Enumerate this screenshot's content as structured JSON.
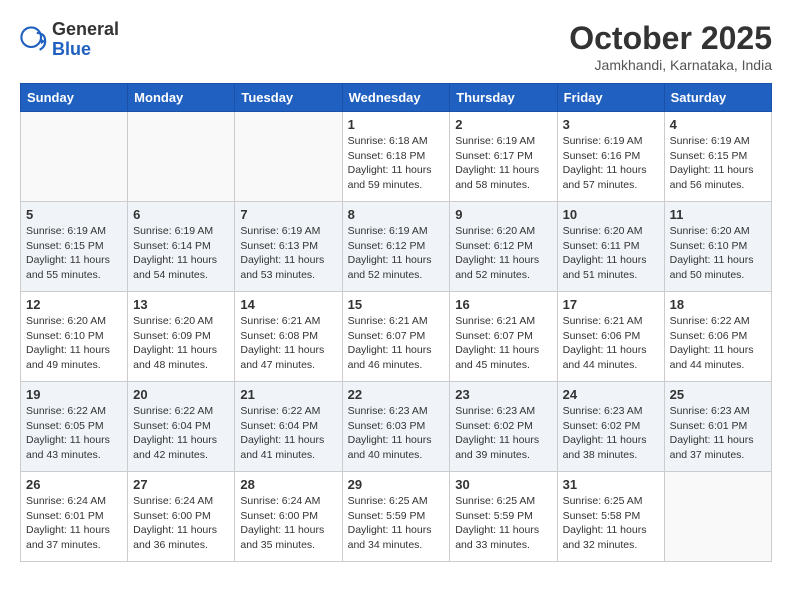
{
  "header": {
    "logo_general": "General",
    "logo_blue": "Blue",
    "month_title": "October 2025",
    "location": "Jamkhandi, Karnataka, India"
  },
  "weekdays": [
    "Sunday",
    "Monday",
    "Tuesday",
    "Wednesday",
    "Thursday",
    "Friday",
    "Saturday"
  ],
  "weeks": [
    [
      {
        "day": "",
        "info": ""
      },
      {
        "day": "",
        "info": ""
      },
      {
        "day": "",
        "info": ""
      },
      {
        "day": "1",
        "info": "Sunrise: 6:18 AM\nSunset: 6:18 PM\nDaylight: 11 hours\nand 59 minutes."
      },
      {
        "day": "2",
        "info": "Sunrise: 6:19 AM\nSunset: 6:17 PM\nDaylight: 11 hours\nand 58 minutes."
      },
      {
        "day": "3",
        "info": "Sunrise: 6:19 AM\nSunset: 6:16 PM\nDaylight: 11 hours\nand 57 minutes."
      },
      {
        "day": "4",
        "info": "Sunrise: 6:19 AM\nSunset: 6:15 PM\nDaylight: 11 hours\nand 56 minutes."
      }
    ],
    [
      {
        "day": "5",
        "info": "Sunrise: 6:19 AM\nSunset: 6:15 PM\nDaylight: 11 hours\nand 55 minutes."
      },
      {
        "day": "6",
        "info": "Sunrise: 6:19 AM\nSunset: 6:14 PM\nDaylight: 11 hours\nand 54 minutes."
      },
      {
        "day": "7",
        "info": "Sunrise: 6:19 AM\nSunset: 6:13 PM\nDaylight: 11 hours\nand 53 minutes."
      },
      {
        "day": "8",
        "info": "Sunrise: 6:19 AM\nSunset: 6:12 PM\nDaylight: 11 hours\nand 52 minutes."
      },
      {
        "day": "9",
        "info": "Sunrise: 6:20 AM\nSunset: 6:12 PM\nDaylight: 11 hours\nand 52 minutes."
      },
      {
        "day": "10",
        "info": "Sunrise: 6:20 AM\nSunset: 6:11 PM\nDaylight: 11 hours\nand 51 minutes."
      },
      {
        "day": "11",
        "info": "Sunrise: 6:20 AM\nSunset: 6:10 PM\nDaylight: 11 hours\nand 50 minutes."
      }
    ],
    [
      {
        "day": "12",
        "info": "Sunrise: 6:20 AM\nSunset: 6:10 PM\nDaylight: 11 hours\nand 49 minutes."
      },
      {
        "day": "13",
        "info": "Sunrise: 6:20 AM\nSunset: 6:09 PM\nDaylight: 11 hours\nand 48 minutes."
      },
      {
        "day": "14",
        "info": "Sunrise: 6:21 AM\nSunset: 6:08 PM\nDaylight: 11 hours\nand 47 minutes."
      },
      {
        "day": "15",
        "info": "Sunrise: 6:21 AM\nSunset: 6:07 PM\nDaylight: 11 hours\nand 46 minutes."
      },
      {
        "day": "16",
        "info": "Sunrise: 6:21 AM\nSunset: 6:07 PM\nDaylight: 11 hours\nand 45 minutes."
      },
      {
        "day": "17",
        "info": "Sunrise: 6:21 AM\nSunset: 6:06 PM\nDaylight: 11 hours\nand 44 minutes."
      },
      {
        "day": "18",
        "info": "Sunrise: 6:22 AM\nSunset: 6:06 PM\nDaylight: 11 hours\nand 44 minutes."
      }
    ],
    [
      {
        "day": "19",
        "info": "Sunrise: 6:22 AM\nSunset: 6:05 PM\nDaylight: 11 hours\nand 43 minutes."
      },
      {
        "day": "20",
        "info": "Sunrise: 6:22 AM\nSunset: 6:04 PM\nDaylight: 11 hours\nand 42 minutes."
      },
      {
        "day": "21",
        "info": "Sunrise: 6:22 AM\nSunset: 6:04 PM\nDaylight: 11 hours\nand 41 minutes."
      },
      {
        "day": "22",
        "info": "Sunrise: 6:23 AM\nSunset: 6:03 PM\nDaylight: 11 hours\nand 40 minutes."
      },
      {
        "day": "23",
        "info": "Sunrise: 6:23 AM\nSunset: 6:02 PM\nDaylight: 11 hours\nand 39 minutes."
      },
      {
        "day": "24",
        "info": "Sunrise: 6:23 AM\nSunset: 6:02 PM\nDaylight: 11 hours\nand 38 minutes."
      },
      {
        "day": "25",
        "info": "Sunrise: 6:23 AM\nSunset: 6:01 PM\nDaylight: 11 hours\nand 37 minutes."
      }
    ],
    [
      {
        "day": "26",
        "info": "Sunrise: 6:24 AM\nSunset: 6:01 PM\nDaylight: 11 hours\nand 37 minutes."
      },
      {
        "day": "27",
        "info": "Sunrise: 6:24 AM\nSunset: 6:00 PM\nDaylight: 11 hours\nand 36 minutes."
      },
      {
        "day": "28",
        "info": "Sunrise: 6:24 AM\nSunset: 6:00 PM\nDaylight: 11 hours\nand 35 minutes."
      },
      {
        "day": "29",
        "info": "Sunrise: 6:25 AM\nSunset: 5:59 PM\nDaylight: 11 hours\nand 34 minutes."
      },
      {
        "day": "30",
        "info": "Sunrise: 6:25 AM\nSunset: 5:59 PM\nDaylight: 11 hours\nand 33 minutes."
      },
      {
        "day": "31",
        "info": "Sunrise: 6:25 AM\nSunset: 5:58 PM\nDaylight: 11 hours\nand 32 minutes."
      },
      {
        "day": "",
        "info": ""
      }
    ]
  ]
}
